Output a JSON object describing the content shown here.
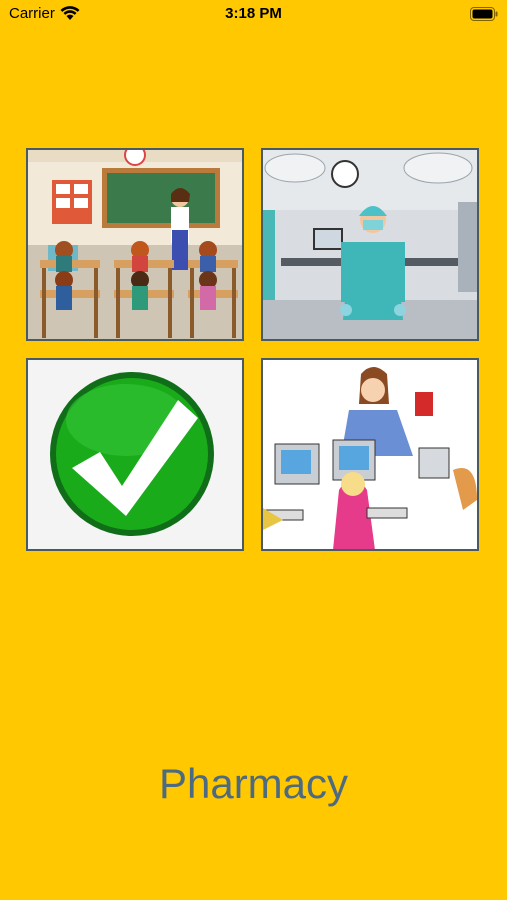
{
  "status_bar": {
    "carrier": "Carrier",
    "time": "3:18 PM",
    "wifi_icon": "wifi-icon",
    "battery_icon": "battery-icon"
  },
  "colors": {
    "background": "#FFC800",
    "word_text": "#4E6A80",
    "tile_border": "#4a5a63",
    "check_green": "#1a9c1a"
  },
  "tiles": [
    {
      "id": "classroom",
      "icon": "classroom-picture"
    },
    {
      "id": "surgeon",
      "icon": "surgeon-picture"
    },
    {
      "id": "checkmark",
      "icon": "green-checkmark-picture"
    },
    {
      "id": "computer-lab",
      "icon": "computer-lab-picture"
    }
  ],
  "word": "Pharmacy"
}
